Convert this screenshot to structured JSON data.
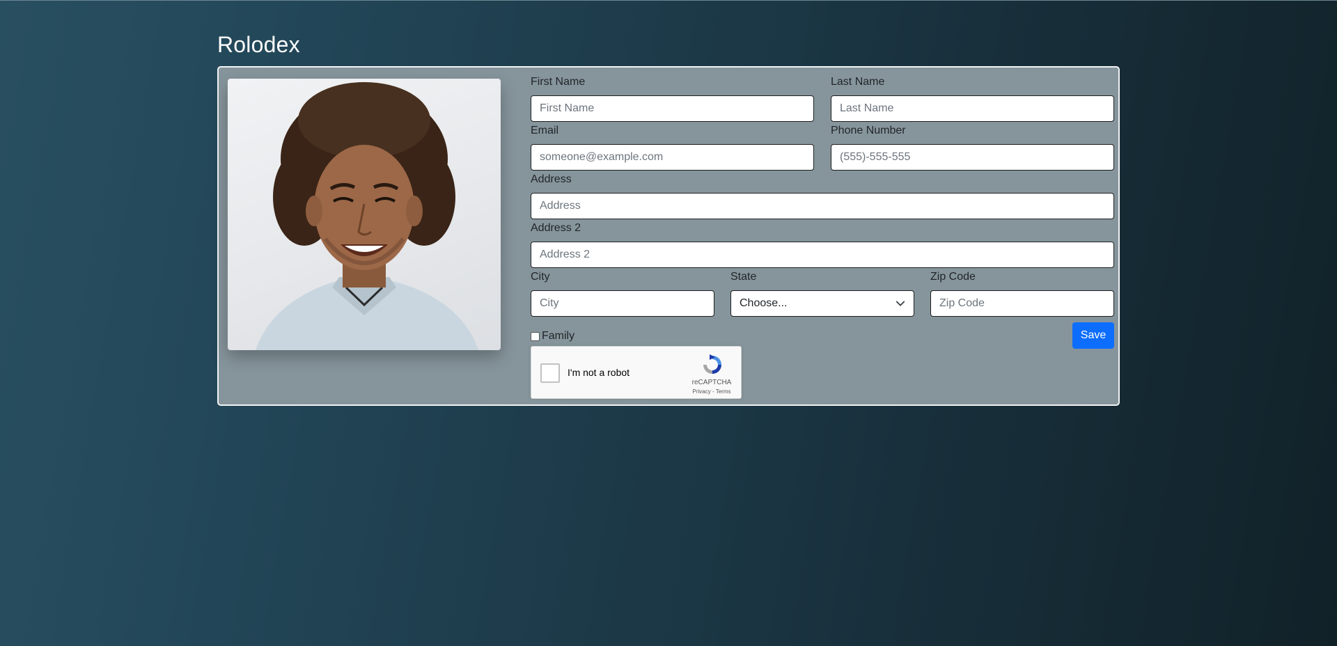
{
  "app": {
    "title": "Rolodex"
  },
  "form": {
    "first_name": {
      "label": "First Name",
      "placeholder": "First Name"
    },
    "last_name": {
      "label": "Last Name",
      "placeholder": "Last Name"
    },
    "email": {
      "label": "Email",
      "placeholder": "someone@example.com"
    },
    "phone": {
      "label": "Phone Number",
      "placeholder": "(555)-555-555"
    },
    "address": {
      "label": "Address",
      "placeholder": "Address"
    },
    "address2": {
      "label": "Address 2",
      "placeholder": "Address 2"
    },
    "city": {
      "label": "City",
      "placeholder": "City"
    },
    "state": {
      "label": "State",
      "selected": "Choose..."
    },
    "zip": {
      "label": "Zip Code",
      "placeholder": "Zip Code"
    },
    "family": {
      "label": "Family",
      "checked": false
    },
    "save_label": "Save"
  },
  "recaptcha": {
    "label": "I'm not a robot",
    "brand": "reCAPTCHA",
    "links": "Privacy - Terms"
  },
  "colors": {
    "card_bg": "#86959c",
    "save_button": "#0d6efd"
  }
}
